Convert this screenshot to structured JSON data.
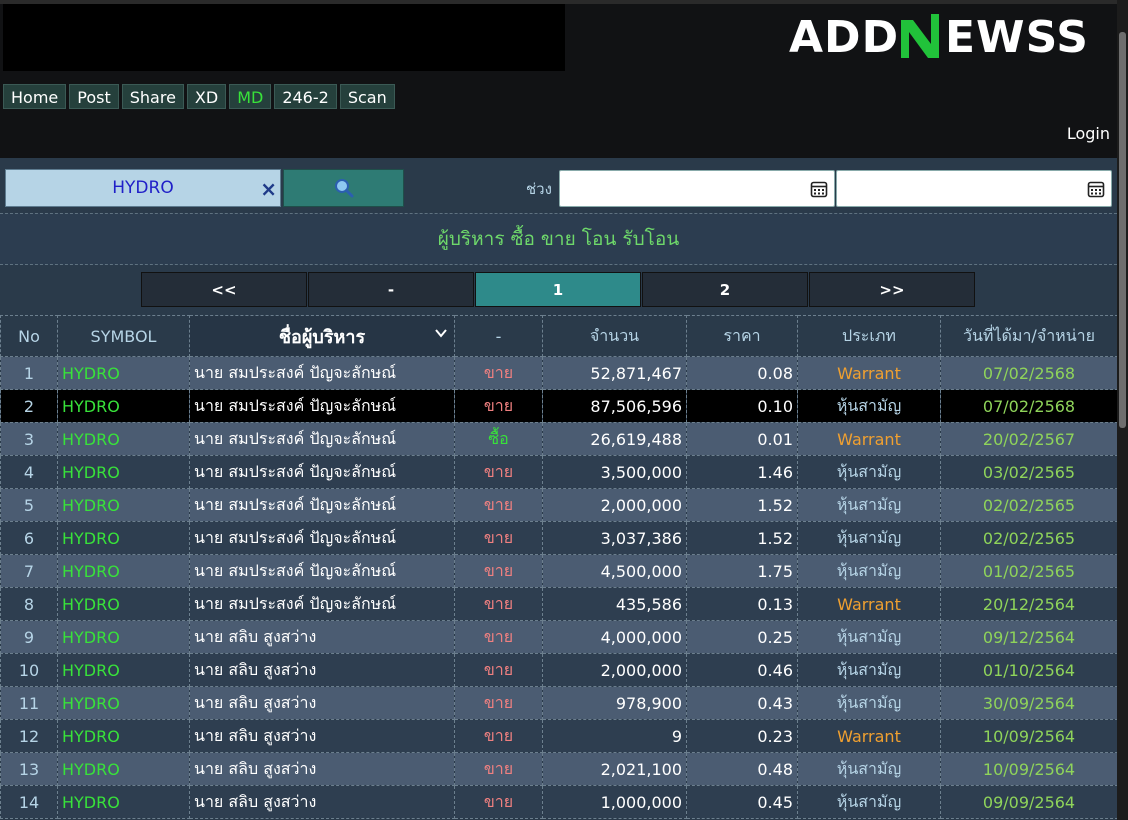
{
  "logo_text": "ADDNEWSS",
  "nav": [
    "Home",
    "Post",
    "Share",
    "XD",
    "MD",
    "246-2",
    "Scan"
  ],
  "nav_active": "MD",
  "login": "Login",
  "search": {
    "value": "HYDRO",
    "clear_glyph": "×",
    "button_icon": "magnifier-icon"
  },
  "range_label": "ช่วง",
  "date_from": "",
  "date_to": "",
  "title": "ผู้บริหาร ซื้อ ขาย โอน รับโอน",
  "pager": [
    "<<",
    "-",
    "1",
    "2",
    ">>"
  ],
  "pager_active": "1",
  "columns": [
    "No",
    "SYMBOL",
    "ชื่อผู้บริหาร",
    "-",
    "จำนวน",
    "ราคา",
    "ประเภท",
    "วันที่ได้มา/จำหน่าย"
  ],
  "rows": [
    {
      "no": "1",
      "symbol": "HYDRO",
      "name": "นาย สมประสงค์ ปัญจะลักษณ์",
      "action": "ขาย",
      "amount": "52,871,467",
      "price": "0.08",
      "type": "Warrant",
      "date": "07/02/2568"
    },
    {
      "no": "2",
      "symbol": "HYDRO",
      "name": "นาย สมประสงค์ ปัญจะลักษณ์",
      "action": "ขาย",
      "amount": "87,506,596",
      "price": "0.10",
      "type": "หุ้นสามัญ",
      "date": "07/02/2568"
    },
    {
      "no": "3",
      "symbol": "HYDRO",
      "name": "นาย สมประสงค์ ปัญจะลักษณ์",
      "action": "ซื้อ",
      "amount": "26,619,488",
      "price": "0.01",
      "type": "Warrant",
      "date": "20/02/2567"
    },
    {
      "no": "4",
      "symbol": "HYDRO",
      "name": "นาย สมประสงค์ ปัญจะลักษณ์",
      "action": "ขาย",
      "amount": "3,500,000",
      "price": "1.46",
      "type": "หุ้นสามัญ",
      "date": "03/02/2565"
    },
    {
      "no": "5",
      "symbol": "HYDRO",
      "name": "นาย สมประสงค์ ปัญจะลักษณ์",
      "action": "ขาย",
      "amount": "2,000,000",
      "price": "1.52",
      "type": "หุ้นสามัญ",
      "date": "02/02/2565"
    },
    {
      "no": "6",
      "symbol": "HYDRO",
      "name": "นาย สมประสงค์ ปัญจะลักษณ์",
      "action": "ขาย",
      "amount": "3,037,386",
      "price": "1.52",
      "type": "หุ้นสามัญ",
      "date": "02/02/2565"
    },
    {
      "no": "7",
      "symbol": "HYDRO",
      "name": "นาย สมประสงค์ ปัญจะลักษณ์",
      "action": "ขาย",
      "amount": "4,500,000",
      "price": "1.75",
      "type": "หุ้นสามัญ",
      "date": "01/02/2565"
    },
    {
      "no": "8",
      "symbol": "HYDRO",
      "name": "นาย สมประสงค์ ปัญจะลักษณ์",
      "action": "ขาย",
      "amount": "435,586",
      "price": "0.13",
      "type": "Warrant",
      "date": "20/12/2564"
    },
    {
      "no": "9",
      "symbol": "HYDRO",
      "name": "นาย สลิบ สูงสว่าง",
      "action": "ขาย",
      "amount": "4,000,000",
      "price": "0.25",
      "type": "หุ้นสามัญ",
      "date": "09/12/2564"
    },
    {
      "no": "10",
      "symbol": "HYDRO",
      "name": "นาย สลิบ สูงสว่าง",
      "action": "ขาย",
      "amount": "2,000,000",
      "price": "0.46",
      "type": "หุ้นสามัญ",
      "date": "01/10/2564"
    },
    {
      "no": "11",
      "symbol": "HYDRO",
      "name": "นาย สลิบ สูงสว่าง",
      "action": "ขาย",
      "amount": "978,900",
      "price": "0.43",
      "type": "หุ้นสามัญ",
      "date": "30/09/2564"
    },
    {
      "no": "12",
      "symbol": "HYDRO",
      "name": "นาย สลิบ สูงสว่าง",
      "action": "ขาย",
      "amount": "9",
      "price": "0.23",
      "type": "Warrant",
      "date": "10/09/2564"
    },
    {
      "no": "13",
      "symbol": "HYDRO",
      "name": "นาย สลิบ สูงสว่าง",
      "action": "ขาย",
      "amount": "2,021,100",
      "price": "0.48",
      "type": "หุ้นสามัญ",
      "date": "10/09/2564"
    },
    {
      "no": "14",
      "symbol": "HYDRO",
      "name": "นาย สลิบ สูงสว่าง",
      "action": "ขาย",
      "amount": "1,000,000",
      "price": "0.45",
      "type": "หุ้นสามัญ",
      "date": "09/09/2564"
    }
  ],
  "colors": {
    "accent_green": "#38e23a",
    "warrant": "#f0a030",
    "common": "#b6d4e6",
    "sell": "#f08080",
    "date": "#8fd45a"
  }
}
